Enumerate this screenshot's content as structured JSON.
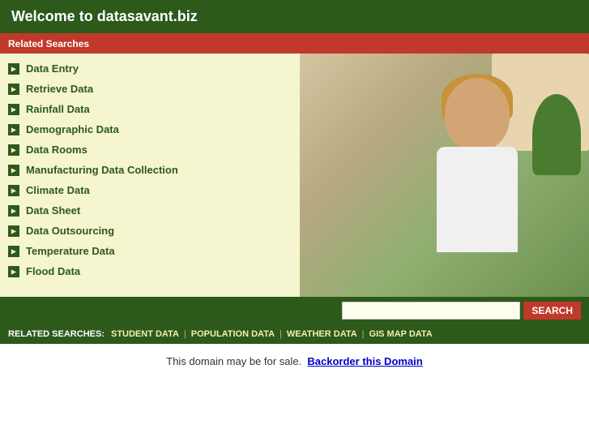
{
  "header": {
    "title": "Welcome to datasavant.biz"
  },
  "related_bar": {
    "label": "Related Searches"
  },
  "links": [
    {
      "label": "Data Entry"
    },
    {
      "label": "Retrieve Data"
    },
    {
      "label": "Rainfall Data"
    },
    {
      "label": "Demographic Data"
    },
    {
      "label": "Data Rooms"
    },
    {
      "label": "Manufacturing Data Collection"
    },
    {
      "label": "Climate Data"
    },
    {
      "label": "Data Sheet"
    },
    {
      "label": "Data Outsourcing"
    },
    {
      "label": "Temperature Data"
    },
    {
      "label": "Flood Data"
    }
  ],
  "search": {
    "placeholder": "",
    "button_label": "SEARCH"
  },
  "bottom_bar": {
    "label": "RELATED SEARCHES:",
    "items": [
      {
        "label": "STUDENT DATA"
      },
      {
        "label": "POPULATION DATA"
      },
      {
        "label": "WEATHER DATA"
      },
      {
        "label": "GIS MAP DATA"
      }
    ]
  },
  "footer": {
    "text": "This domain may be for sale.",
    "link_text": "Backorder this Domain"
  }
}
